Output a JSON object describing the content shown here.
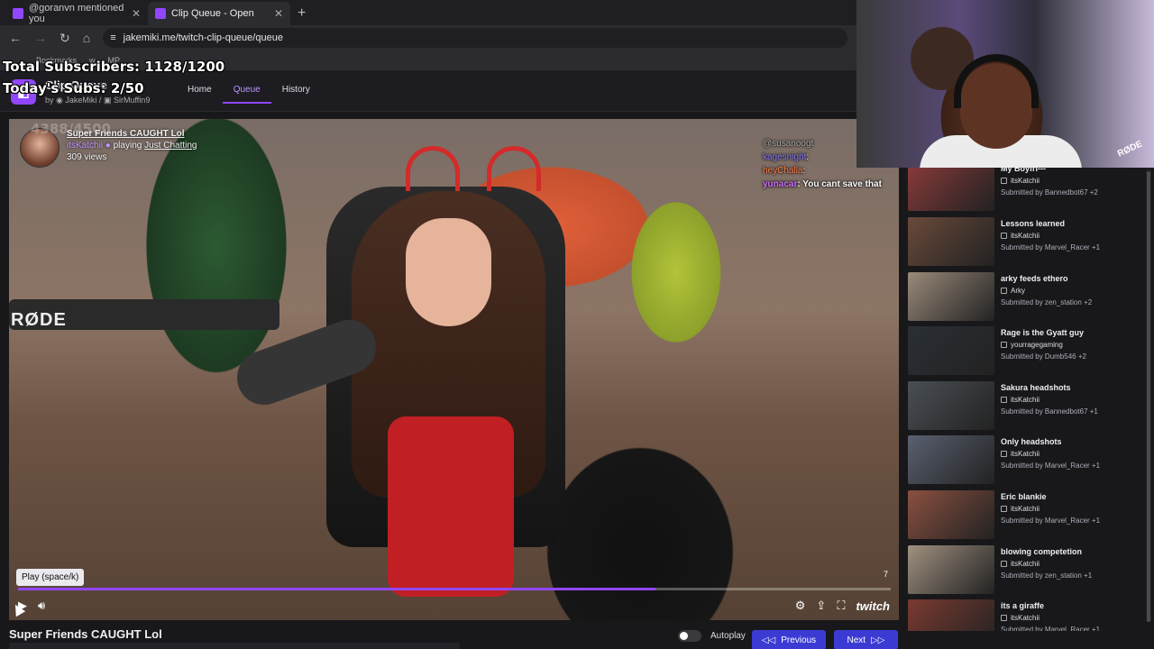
{
  "browser": {
    "tabs": [
      {
        "label": "@goranvn mentioned you",
        "active": false
      },
      {
        "label": "Clip Queue - Open",
        "active": true
      }
    ],
    "url": "jakemiki.me/twitch-clip-queue/queue",
    "bookmarks": [
      "Bookmarks",
      "w",
      "MP"
    ]
  },
  "overlay": {
    "total_subs": "Total Subscribers: 1128/1200",
    "today_subs": "Today's Subs: 2/50",
    "faint_count": "4388/4500"
  },
  "app": {
    "title": "Clip Queue",
    "by": "by",
    "author1": "JakeMiki",
    "author2": "SirMuffin9",
    "nav": {
      "home": "Home",
      "queue": "Queue",
      "history": "History"
    }
  },
  "player": {
    "clip_title": "Super Friends CAUGHT Lol",
    "channel": "itsKatchii",
    "playing": "playing",
    "game": "Just Chatting",
    "views": "309 views",
    "tooltip": "Play (space/k)",
    "seek_count": "7",
    "progress": 0.73,
    "brand": "twitch",
    "mic_brand": "RØDE",
    "chat": [
      {
        "user": "@susanoogt",
        "text": ""
      },
      {
        "user": "kagesnight",
        "text": ":"
      },
      {
        "user": "heyChalla",
        "text": ":"
      },
      {
        "user": "yunacar",
        "text": ": You cant save that"
      }
    ]
  },
  "below": {
    "title": "Super Friends CAUGHT Lol",
    "autoplay_label": "Autoplay",
    "prev_label": "Previous",
    "next_label": "Next"
  },
  "webcam": {
    "mic_brand": "RØDE"
  },
  "queue": [
    {
      "title": "My Boyfri---",
      "channel": "itsKatchii",
      "submitted": "Submitted by Bannedbot67 +2",
      "thumb": "#8a3a3a"
    },
    {
      "title": "Lessons learned",
      "channel": "itsKatchii",
      "submitted": "Submitted by Marvel_Racer +1",
      "thumb": "#6a4a3a"
    },
    {
      "title": "arky feeds ethero",
      "channel": "Arky",
      "submitted": "Submitted by zen_station +2",
      "thumb": "#9a8a7a"
    },
    {
      "title": "Rage is the Gyatt guy",
      "channel": "yourragegaming",
      "submitted": "Submitted by Dumb546 +2",
      "thumb": "#2a2f35"
    },
    {
      "title": "Sakura headshots",
      "channel": "itsKatchii",
      "submitted": "Submitted by Bannedbot67 +1",
      "thumb": "#4a4f55"
    },
    {
      "title": "Only headshots",
      "channel": "itsKatchii",
      "submitted": "Submitted by Marvel_Racer +1",
      "thumb": "#5a6070"
    },
    {
      "title": "Eric blankie",
      "channel": "itsKatchii",
      "submitted": "Submitted by Marvel_Racer +1",
      "thumb": "#8a5040"
    },
    {
      "title": "blowing competetion",
      "channel": "itsKatchii",
      "submitted": "Submitted by zen_station +1",
      "thumb": "#a09080"
    },
    {
      "title": "its a giraffe",
      "channel": "itsKatchii",
      "submitted": "Submitted by Marvel_Racer +1",
      "thumb": "#7a3a30"
    }
  ]
}
